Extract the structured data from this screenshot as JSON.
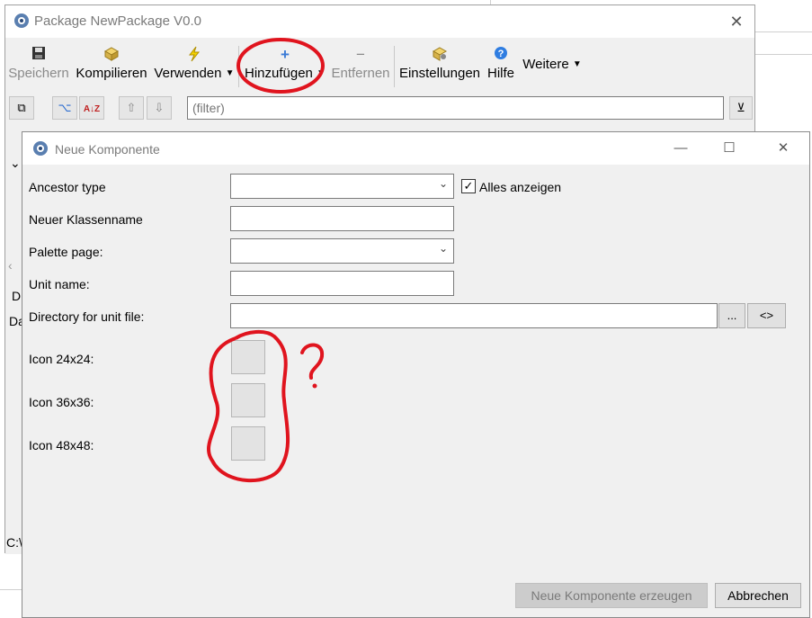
{
  "package_window": {
    "title": "Package NewPackage V0.0",
    "close_glyph": "✕",
    "toolbar": {
      "save": {
        "label": "Speichern",
        "icon": "save-icon"
      },
      "compile": {
        "label": "Kompilieren",
        "icon": "compile-icon"
      },
      "use": {
        "label": "Verwenden",
        "icon": "lightning-icon"
      },
      "add": {
        "label": "Hinzufügen",
        "icon": "plus-icon"
      },
      "remove": {
        "label": "Entfernen",
        "icon": "minus-icon"
      },
      "settings": {
        "label": "Einstellungen",
        "icon": "settings-icon"
      },
      "help": {
        "label": "Hilfe",
        "icon": "help-icon"
      },
      "more": {
        "label": "Weitere"
      }
    },
    "filter_placeholder": "(filter)",
    "left_fragments": [
      "D",
      "Da",
      "C:\\"
    ]
  },
  "dialog": {
    "title": "Neue Komponente",
    "fields": {
      "ancestor_type": {
        "label": "Ancestor type",
        "value": ""
      },
      "show_all": {
        "label": "Alles anzeigen",
        "checked": true
      },
      "class_name": {
        "label": "Neuer Klassenname",
        "value": ""
      },
      "palette_page": {
        "label": "Palette page:",
        "value": ""
      },
      "unit_name": {
        "label": "Unit name:",
        "value": ""
      },
      "directory": {
        "label": "Directory for unit file:",
        "value": "",
        "browse": "...",
        "toggle": "<>"
      },
      "icon24": {
        "label": "Icon 24x24:"
      },
      "icon36": {
        "label": "Icon 36x36:"
      },
      "icon48": {
        "label": "Icon 48x48:"
      }
    },
    "buttons": {
      "create": "Neue Komponente erzeugen",
      "cancel": "Abbrechen"
    }
  },
  "colors": {
    "annotation_red": "#e0141e",
    "window_bg": "#f0f0f0"
  }
}
